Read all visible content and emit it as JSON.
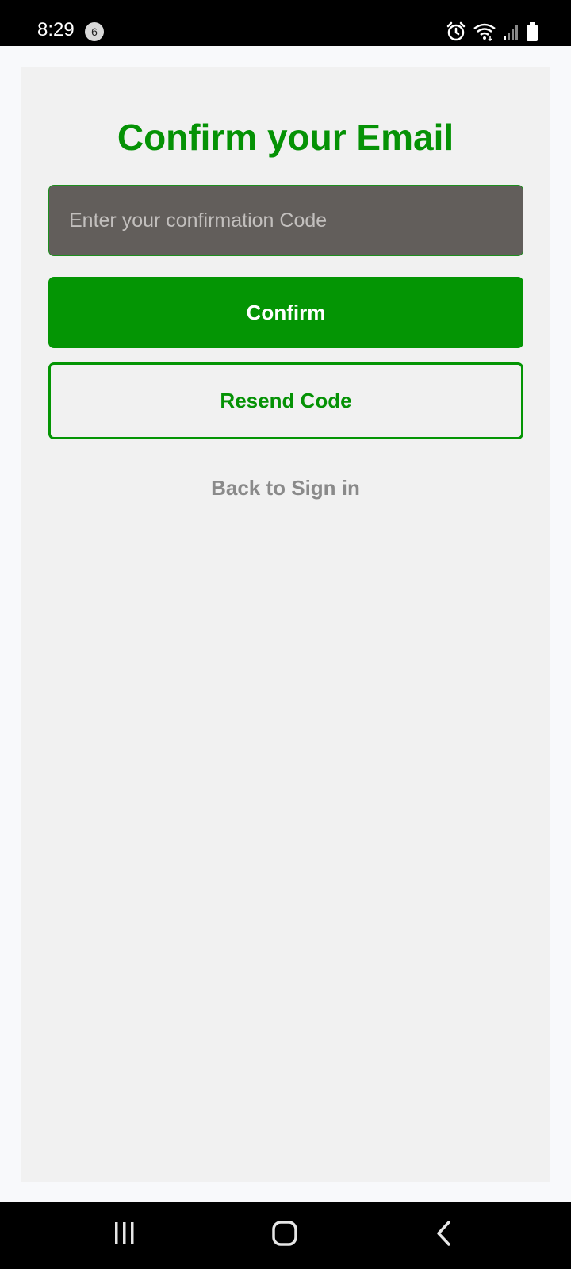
{
  "status_bar": {
    "time": "8:29",
    "notification_count": "6",
    "icons": [
      "alarm-icon",
      "wifi-icon",
      "signal-icon",
      "battery-icon"
    ]
  },
  "screen": {
    "title": "Confirm your Email",
    "code_input": {
      "placeholder": "Enter your confirmation Code",
      "value": ""
    },
    "confirm_label": "Confirm",
    "resend_label": "Resend Code",
    "back_link": "Back to Sign in"
  },
  "nav_bar": {
    "buttons": [
      "recent-apps-icon",
      "home-icon",
      "back-icon"
    ]
  },
  "colors": {
    "accent": "#049504",
    "input_bg": "#625e5b",
    "card_bg": "#f1f1f1",
    "link_gray": "#8a8a8a"
  }
}
